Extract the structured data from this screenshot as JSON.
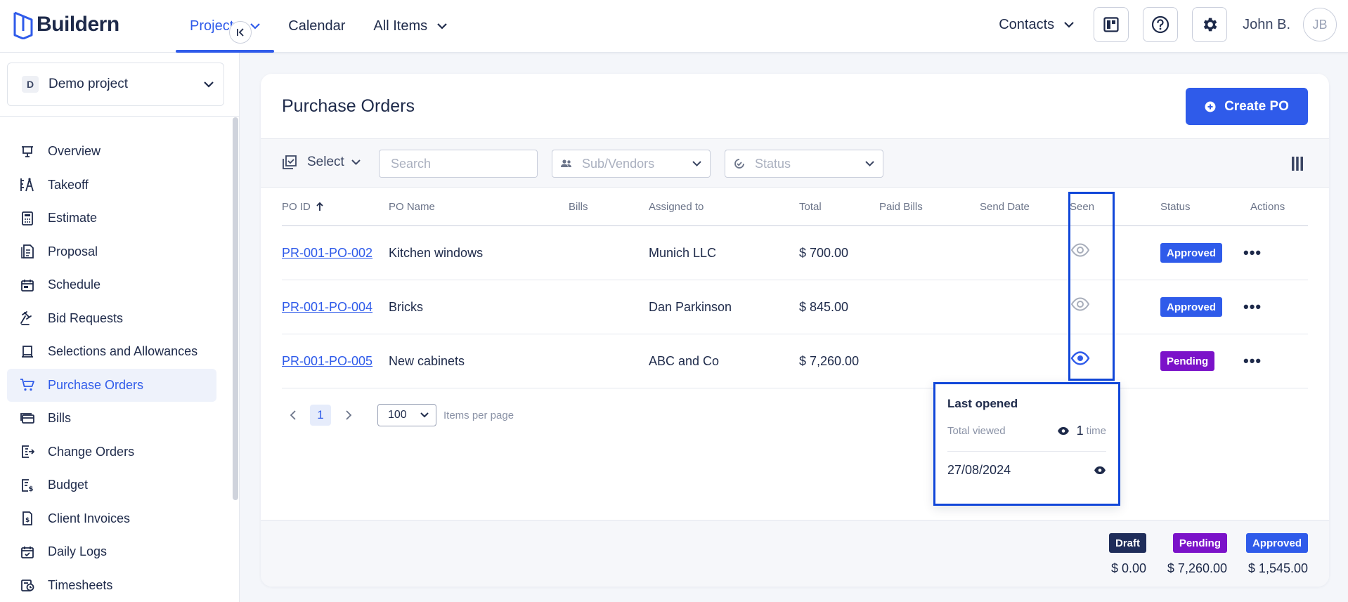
{
  "app": {
    "name": "Buildern",
    "brand_color": "#2f5bea"
  },
  "nav": {
    "items": [
      {
        "label": "Projects",
        "active": true,
        "dropdown": true
      },
      {
        "label": "Calendar",
        "active": false,
        "dropdown": false
      },
      {
        "label": "All Items",
        "active": false,
        "dropdown": true
      }
    ],
    "contacts_label": "Contacts",
    "user_name": "John B.",
    "avatar_initials": "JB"
  },
  "sidebar": {
    "project_badge": "D",
    "project_name": "Demo project",
    "items": [
      {
        "label": "Overview",
        "icon": "presentation-icon"
      },
      {
        "label": "Takeoff",
        "icon": "takeoff-icon"
      },
      {
        "label": "Estimate",
        "icon": "calculator-icon"
      },
      {
        "label": "Proposal",
        "icon": "proposal-icon"
      },
      {
        "label": "Schedule",
        "icon": "calendar-icon"
      },
      {
        "label": "Bid Requests",
        "icon": "gavel-icon"
      },
      {
        "label": "Selections and Allowances",
        "icon": "selections-icon"
      },
      {
        "label": "Purchase Orders",
        "icon": "cart-icon",
        "active": true
      },
      {
        "label": "Bills",
        "icon": "bills-icon"
      },
      {
        "label": "Change Orders",
        "icon": "change-orders-icon"
      },
      {
        "label": "Budget",
        "icon": "budget-icon"
      },
      {
        "label": "Client Invoices",
        "icon": "invoice-icon"
      },
      {
        "label": "Daily Logs",
        "icon": "daily-log-icon"
      },
      {
        "label": "Timesheets",
        "icon": "timesheet-icon"
      }
    ]
  },
  "page": {
    "title": "Purchase Orders",
    "create_label": "Create PO"
  },
  "filters": {
    "select_label": "Select",
    "search_placeholder": "Search",
    "vendors_placeholder": "Sub/Vendors",
    "status_placeholder": "Status"
  },
  "table": {
    "columns": [
      "PO ID",
      "PO Name",
      "Bills",
      "Assigned to",
      "Total",
      "Paid Bills",
      "Send Date",
      "Seen",
      "Status",
      "Actions"
    ],
    "rows": [
      {
        "id": "PR-001-PO-002",
        "name": "Kitchen windows",
        "bills": "",
        "assigned": "Munich LLC",
        "total": "$ 700.00",
        "paid": "",
        "send_date": "",
        "seen": false,
        "status": "Approved"
      },
      {
        "id": "PR-001-PO-004",
        "name": "Bricks",
        "bills": "",
        "assigned": "Dan Parkinson",
        "total": "$ 845.00",
        "paid": "",
        "send_date": "",
        "seen": false,
        "status": "Approved"
      },
      {
        "id": "PR-001-PO-005",
        "name": "New cabinets",
        "bills": "",
        "assigned": "ABC and Co",
        "total": "$ 7,260.00",
        "paid": "",
        "send_date": "",
        "seen": true,
        "status": "Pending"
      }
    ]
  },
  "pagination": {
    "current_page": "1",
    "per_page": "100",
    "per_page_label": "Items per page"
  },
  "popover": {
    "title": "Last opened",
    "total_viewed_label": "Total viewed",
    "count": "1",
    "count_unit": "time",
    "date": "27/08/2024"
  },
  "summary": {
    "draft_label": "Draft",
    "draft_amount": "$ 0.00",
    "pending_label": "Pending",
    "pending_amount": "$ 7,260.00",
    "approved_label": "Approved",
    "approved_amount": "$ 1,545.00"
  },
  "colors": {
    "approved": "#2f5bea",
    "pending": "#7b12c9",
    "draft": "#1f2d5a",
    "highlight": "#1147d9"
  }
}
